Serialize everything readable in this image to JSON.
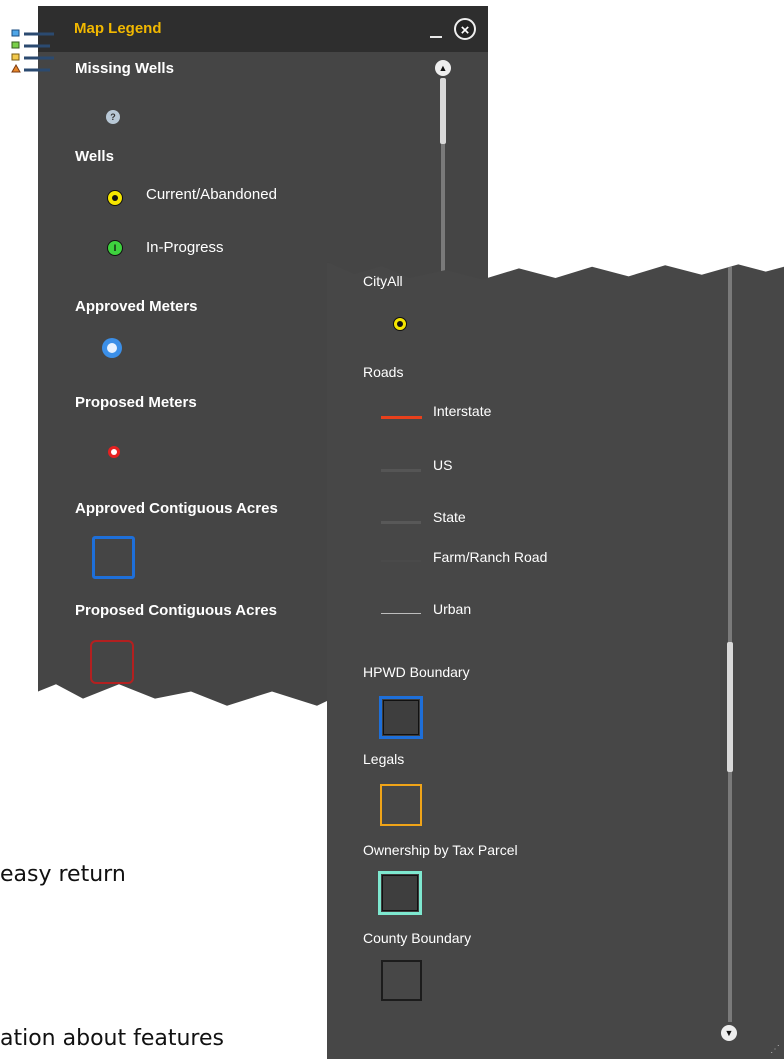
{
  "background_text": {
    "line1": "easy return",
    "line2": "ation about features"
  },
  "panel_a": {
    "title": "Map Legend",
    "close_symbol": "×",
    "sections": {
      "missing_wells": "Missing Wells",
      "wells": "Wells",
      "current_abandoned": "Current/Abandoned",
      "in_progress": "In-Progress",
      "approved_meters": "Approved Meters",
      "proposed_meters": "Proposed Meters",
      "approved_contiguous": "Approved Contiguous Acres",
      "proposed_contiguous": "Proposed Contiguous Acres"
    },
    "icons": {
      "missing_well": "?",
      "in_progress": "I"
    }
  },
  "panel_b": {
    "cityall": "CityAll",
    "roads": "Roads",
    "interstate": "Interstate",
    "us": "US",
    "state": "State",
    "farm_ranch": "Farm/Ranch Road",
    "urban": "Urban",
    "hpwd": "HPWD Boundary",
    "legals": "Legals",
    "ownership": "Ownership by Tax Parcel",
    "county": "County Boundary"
  },
  "colors": {
    "title": "#f2b800",
    "interstate": "#e8401c",
    "hpwd": "#1e6fd9",
    "legals": "#f0a418",
    "ownership": "#7ee8d0",
    "county": "#1c1c1c",
    "approved_acres": "#1e6fd9",
    "proposed_acres": "#b32020"
  }
}
